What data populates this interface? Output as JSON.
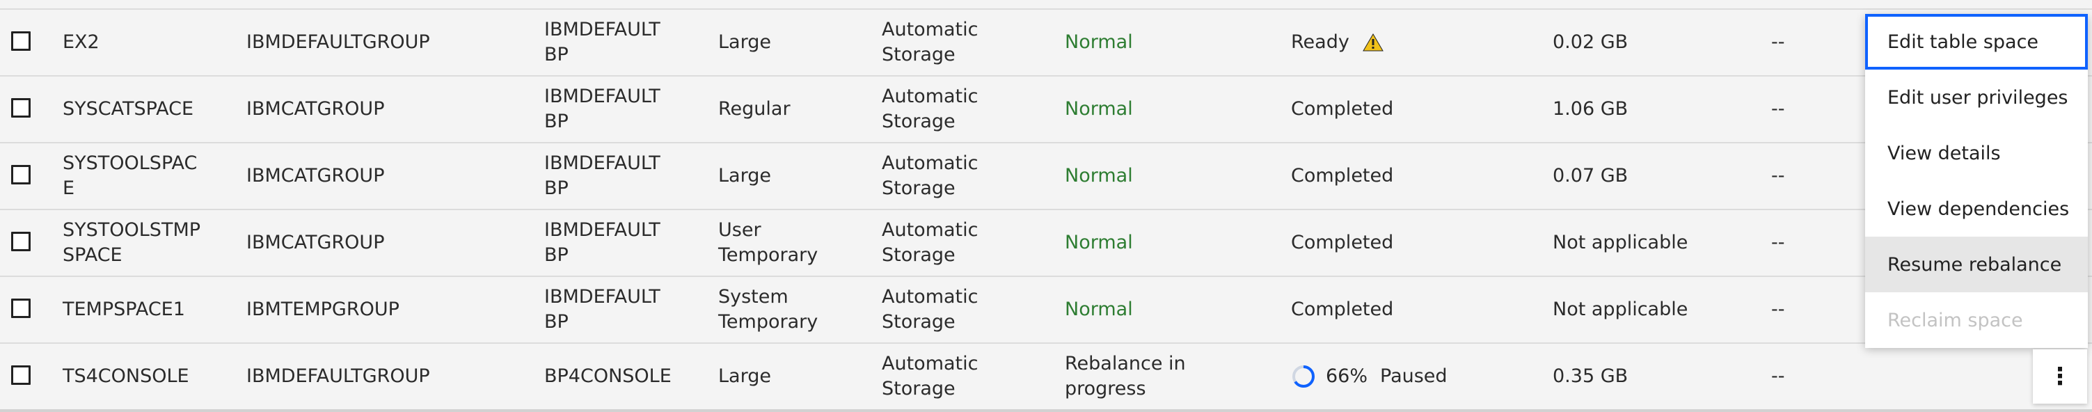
{
  "rows": [
    {
      "name": "EX2",
      "group": "IBMDEFAULTGROUP",
      "bufferpool": "IBMDEFAULT BP",
      "type": "Large",
      "management": "Automatic Storage",
      "state": "Normal",
      "rebalance": "Ready",
      "rebalance_icon": "warning-icon",
      "size": "0.02 GB",
      "extra": "--"
    },
    {
      "name": "SYSCATSPACE",
      "group": "IBMCATGROUP",
      "bufferpool": "IBMDEFAULT BP",
      "type": "Regular",
      "management": "Automatic Storage",
      "state": "Normal",
      "rebalance": "Completed",
      "size": "1.06 GB",
      "extra": "--"
    },
    {
      "name": "SYSTOOLSPAC E",
      "group": "IBMCATGROUP",
      "bufferpool": "IBMDEFAULT BP",
      "type": "Large",
      "management": "Automatic Storage",
      "state": "Normal",
      "rebalance": "Completed",
      "size": "0.07 GB",
      "extra": "--"
    },
    {
      "name": "SYSTOOLSTMP SPACE",
      "group": "IBMCATGROUP",
      "bufferpool": "IBMDEFAULT BP",
      "type": "User Temporary",
      "management": "Automatic Storage",
      "state": "Normal",
      "rebalance": "Completed",
      "size": "Not applicable",
      "extra": "--"
    },
    {
      "name": "TEMPSPACE1",
      "group": "IBMTEMPGROUP",
      "bufferpool": "IBMDEFAULT BP",
      "type": "System Temporary",
      "management": "Automatic Storage",
      "state": "Normal",
      "rebalance": "Completed",
      "size": "Not applicable",
      "extra": "--"
    },
    {
      "name": "TS4CONSOLE",
      "group": "IBMDEFAULTGROUP",
      "bufferpool": "BP4CONSOLE",
      "type": "Large",
      "management": "Automatic Storage",
      "state": "Rebalance in progress",
      "rebalance_percent": "66%",
      "rebalance_progress": 0.66,
      "rebalance_status": "Paused",
      "size": "0.35 GB",
      "extra": "--"
    }
  ],
  "menu": {
    "items": [
      {
        "label": "Edit table space",
        "state": "focused"
      },
      {
        "label": "Edit user privileges",
        "state": "normal"
      },
      {
        "label": "View details",
        "state": "normal"
      },
      {
        "label": "View dependencies",
        "state": "normal"
      },
      {
        "label": "Resume rebalance",
        "state": "hover"
      },
      {
        "label": "Reclaim space",
        "state": "disabled"
      }
    ]
  },
  "overflow_button": {
    "icon": "overflow-menu-vertical-icon",
    "glyph": "⋮"
  },
  "colors": {
    "normal_state": "#2e7d32",
    "focus": "#0f62fe",
    "spinner": "#0f62fe",
    "warning": "#f1c21b"
  }
}
